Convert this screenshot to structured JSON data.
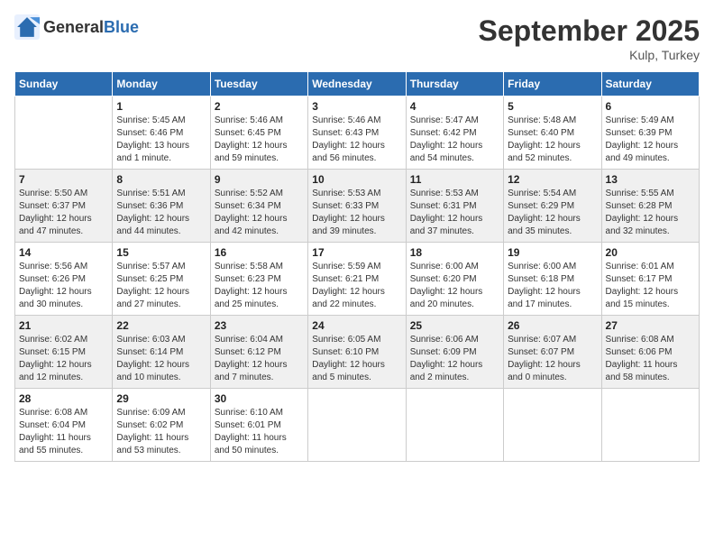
{
  "logo": {
    "text_general": "General",
    "text_blue": "Blue"
  },
  "title": "September 2025",
  "location": "Kulp, Turkey",
  "days_of_week": [
    "Sunday",
    "Monday",
    "Tuesday",
    "Wednesday",
    "Thursday",
    "Friday",
    "Saturday"
  ],
  "weeks": [
    [
      {
        "day": "",
        "info": ""
      },
      {
        "day": "1",
        "info": "Sunrise: 5:45 AM\nSunset: 6:46 PM\nDaylight: 13 hours\nand 1 minute."
      },
      {
        "day": "2",
        "info": "Sunrise: 5:46 AM\nSunset: 6:45 PM\nDaylight: 12 hours\nand 59 minutes."
      },
      {
        "day": "3",
        "info": "Sunrise: 5:46 AM\nSunset: 6:43 PM\nDaylight: 12 hours\nand 56 minutes."
      },
      {
        "day": "4",
        "info": "Sunrise: 5:47 AM\nSunset: 6:42 PM\nDaylight: 12 hours\nand 54 minutes."
      },
      {
        "day": "5",
        "info": "Sunrise: 5:48 AM\nSunset: 6:40 PM\nDaylight: 12 hours\nand 52 minutes."
      },
      {
        "day": "6",
        "info": "Sunrise: 5:49 AM\nSunset: 6:39 PM\nDaylight: 12 hours\nand 49 minutes."
      }
    ],
    [
      {
        "day": "7",
        "info": "Sunrise: 5:50 AM\nSunset: 6:37 PM\nDaylight: 12 hours\nand 47 minutes."
      },
      {
        "day": "8",
        "info": "Sunrise: 5:51 AM\nSunset: 6:36 PM\nDaylight: 12 hours\nand 44 minutes."
      },
      {
        "day": "9",
        "info": "Sunrise: 5:52 AM\nSunset: 6:34 PM\nDaylight: 12 hours\nand 42 minutes."
      },
      {
        "day": "10",
        "info": "Sunrise: 5:53 AM\nSunset: 6:33 PM\nDaylight: 12 hours\nand 39 minutes."
      },
      {
        "day": "11",
        "info": "Sunrise: 5:53 AM\nSunset: 6:31 PM\nDaylight: 12 hours\nand 37 minutes."
      },
      {
        "day": "12",
        "info": "Sunrise: 5:54 AM\nSunset: 6:29 PM\nDaylight: 12 hours\nand 35 minutes."
      },
      {
        "day": "13",
        "info": "Sunrise: 5:55 AM\nSunset: 6:28 PM\nDaylight: 12 hours\nand 32 minutes."
      }
    ],
    [
      {
        "day": "14",
        "info": "Sunrise: 5:56 AM\nSunset: 6:26 PM\nDaylight: 12 hours\nand 30 minutes."
      },
      {
        "day": "15",
        "info": "Sunrise: 5:57 AM\nSunset: 6:25 PM\nDaylight: 12 hours\nand 27 minutes."
      },
      {
        "day": "16",
        "info": "Sunrise: 5:58 AM\nSunset: 6:23 PM\nDaylight: 12 hours\nand 25 minutes."
      },
      {
        "day": "17",
        "info": "Sunrise: 5:59 AM\nSunset: 6:21 PM\nDaylight: 12 hours\nand 22 minutes."
      },
      {
        "day": "18",
        "info": "Sunrise: 6:00 AM\nSunset: 6:20 PM\nDaylight: 12 hours\nand 20 minutes."
      },
      {
        "day": "19",
        "info": "Sunrise: 6:00 AM\nSunset: 6:18 PM\nDaylight: 12 hours\nand 17 minutes."
      },
      {
        "day": "20",
        "info": "Sunrise: 6:01 AM\nSunset: 6:17 PM\nDaylight: 12 hours\nand 15 minutes."
      }
    ],
    [
      {
        "day": "21",
        "info": "Sunrise: 6:02 AM\nSunset: 6:15 PM\nDaylight: 12 hours\nand 12 minutes."
      },
      {
        "day": "22",
        "info": "Sunrise: 6:03 AM\nSunset: 6:14 PM\nDaylight: 12 hours\nand 10 minutes."
      },
      {
        "day": "23",
        "info": "Sunrise: 6:04 AM\nSunset: 6:12 PM\nDaylight: 12 hours\nand 7 minutes."
      },
      {
        "day": "24",
        "info": "Sunrise: 6:05 AM\nSunset: 6:10 PM\nDaylight: 12 hours\nand 5 minutes."
      },
      {
        "day": "25",
        "info": "Sunrise: 6:06 AM\nSunset: 6:09 PM\nDaylight: 12 hours\nand 2 minutes."
      },
      {
        "day": "26",
        "info": "Sunrise: 6:07 AM\nSunset: 6:07 PM\nDaylight: 12 hours\nand 0 minutes."
      },
      {
        "day": "27",
        "info": "Sunrise: 6:08 AM\nSunset: 6:06 PM\nDaylight: 11 hours\nand 58 minutes."
      }
    ],
    [
      {
        "day": "28",
        "info": "Sunrise: 6:08 AM\nSunset: 6:04 PM\nDaylight: 11 hours\nand 55 minutes."
      },
      {
        "day": "29",
        "info": "Sunrise: 6:09 AM\nSunset: 6:02 PM\nDaylight: 11 hours\nand 53 minutes."
      },
      {
        "day": "30",
        "info": "Sunrise: 6:10 AM\nSunset: 6:01 PM\nDaylight: 11 hours\nand 50 minutes."
      },
      {
        "day": "",
        "info": ""
      },
      {
        "day": "",
        "info": ""
      },
      {
        "day": "",
        "info": ""
      },
      {
        "day": "",
        "info": ""
      }
    ]
  ]
}
